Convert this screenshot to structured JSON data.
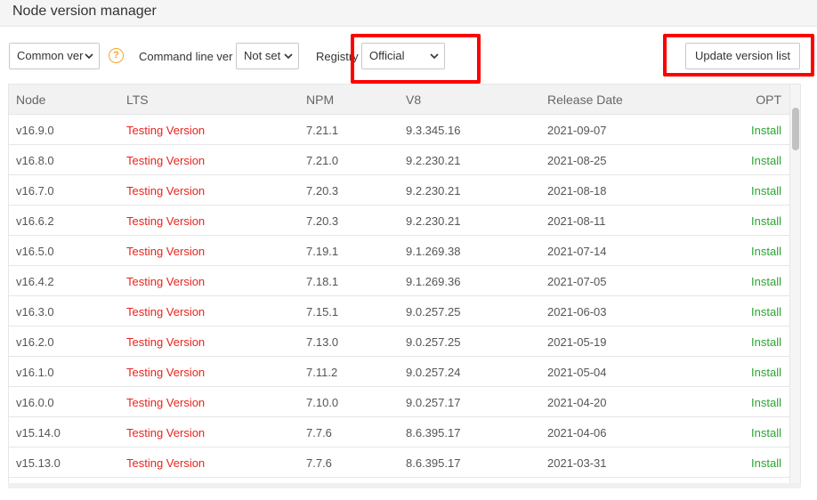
{
  "window": {
    "title": "Node version manager"
  },
  "toolbar": {
    "common_select": "Common ver",
    "help_icon": "?",
    "command_line_label": "Command line ver",
    "command_line_select": "Not set",
    "registry_label": "Registry",
    "registry_select": "Official",
    "update_button": "Update version list"
  },
  "colors": {
    "highlight": "#ff0000",
    "lts_text": "#e8241c",
    "install_text": "#2aa52f",
    "help_icon": "#f5a623"
  },
  "table": {
    "headers": {
      "node": "Node",
      "lts": "LTS",
      "npm": "NPM",
      "v8": "V8",
      "release_date": "Release Date",
      "opt": "OPT"
    },
    "rows": [
      {
        "node": "v16.9.0",
        "lts": "Testing Version",
        "npm": "7.21.1",
        "v8": "9.3.345.16",
        "date": "2021-09-07",
        "opt": "Install"
      },
      {
        "node": "v16.8.0",
        "lts": "Testing Version",
        "npm": "7.21.0",
        "v8": "9.2.230.21",
        "date": "2021-08-25",
        "opt": "Install"
      },
      {
        "node": "v16.7.0",
        "lts": "Testing Version",
        "npm": "7.20.3",
        "v8": "9.2.230.21",
        "date": "2021-08-18",
        "opt": "Install"
      },
      {
        "node": "v16.6.2",
        "lts": "Testing Version",
        "npm": "7.20.3",
        "v8": "9.2.230.21",
        "date": "2021-08-11",
        "opt": "Install"
      },
      {
        "node": "v16.5.0",
        "lts": "Testing Version",
        "npm": "7.19.1",
        "v8": "9.1.269.38",
        "date": "2021-07-14",
        "opt": "Install"
      },
      {
        "node": "v16.4.2",
        "lts": "Testing Version",
        "npm": "7.18.1",
        "v8": "9.1.269.36",
        "date": "2021-07-05",
        "opt": "Install"
      },
      {
        "node": "v16.3.0",
        "lts": "Testing Version",
        "npm": "7.15.1",
        "v8": "9.0.257.25",
        "date": "2021-06-03",
        "opt": "Install"
      },
      {
        "node": "v16.2.0",
        "lts": "Testing Version",
        "npm": "7.13.0",
        "v8": "9.0.257.25",
        "date": "2021-05-19",
        "opt": "Install"
      },
      {
        "node": "v16.1.0",
        "lts": "Testing Version",
        "npm": "7.11.2",
        "v8": "9.0.257.24",
        "date": "2021-05-04",
        "opt": "Install"
      },
      {
        "node": "v16.0.0",
        "lts": "Testing Version",
        "npm": "7.10.0",
        "v8": "9.0.257.17",
        "date": "2021-04-20",
        "opt": "Install"
      },
      {
        "node": "v15.14.0",
        "lts": "Testing Version",
        "npm": "7.7.6",
        "v8": "8.6.395.17",
        "date": "2021-04-06",
        "opt": "Install"
      },
      {
        "node": "v15.13.0",
        "lts": "Testing Version",
        "npm": "7.7.6",
        "v8": "8.6.395.17",
        "date": "2021-03-31",
        "opt": "Install"
      }
    ]
  }
}
